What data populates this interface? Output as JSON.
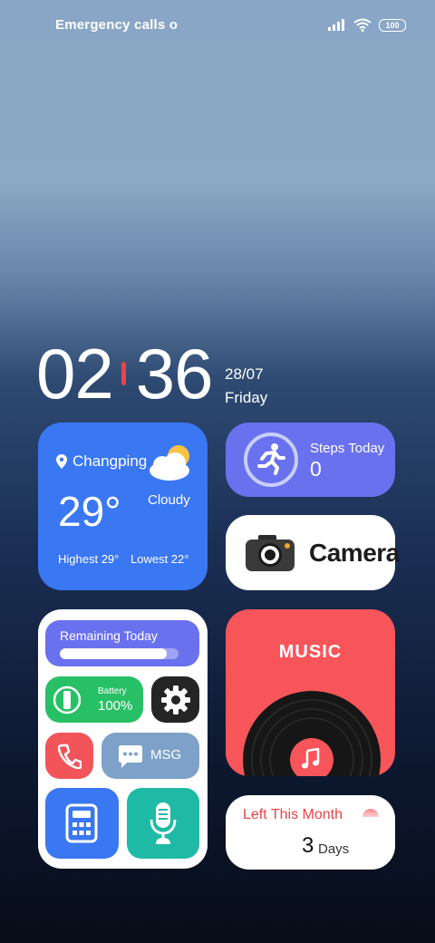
{
  "status_bar": {
    "carrier_text": "Emergency calls o",
    "battery": "100",
    "icons": [
      "signal-icon",
      "wifi-icon",
      "battery-icon"
    ]
  },
  "clock": {
    "hours": "02",
    "minutes": "36",
    "date": "28/07",
    "weekday": "Friday"
  },
  "weather": {
    "location": "Changping",
    "temperature": "29°",
    "condition": "Cloudy",
    "highest": "Highest 29°",
    "lowest": "Lowest 22°",
    "icons": [
      "location-pin-icon",
      "cloud-sun-icon"
    ]
  },
  "steps": {
    "label": "Steps Today",
    "value": "0",
    "icon": "running-person-icon"
  },
  "camera": {
    "label": "Camera",
    "icon": "camera-icon"
  },
  "control_panel": {
    "remaining_label": "Remaining Today",
    "remaining_fraction": 0.9,
    "battery_label": "Battery",
    "battery_value": "100%",
    "msg_label": "MSG",
    "icons": [
      "battery-icon",
      "settings-gear-icon",
      "phone-icon",
      "message-icon",
      "calculator-icon",
      "microphone-icon"
    ]
  },
  "music": {
    "label": "MUSIC",
    "icons": [
      "vinyl-record-icon",
      "music-note-icon"
    ]
  },
  "month": {
    "label": "Left This Month",
    "value": "3",
    "unit": "Days",
    "icon": "half-circle-icon"
  },
  "colors": {
    "weather": "#3a77f2",
    "steps": "#6a71ee",
    "music": "#f7555a",
    "battery_tile": "#28c066",
    "voice_tile": "#1fbaa6",
    "msg_tile": "#7da1c8",
    "clock_separator": "#e8444a"
  }
}
